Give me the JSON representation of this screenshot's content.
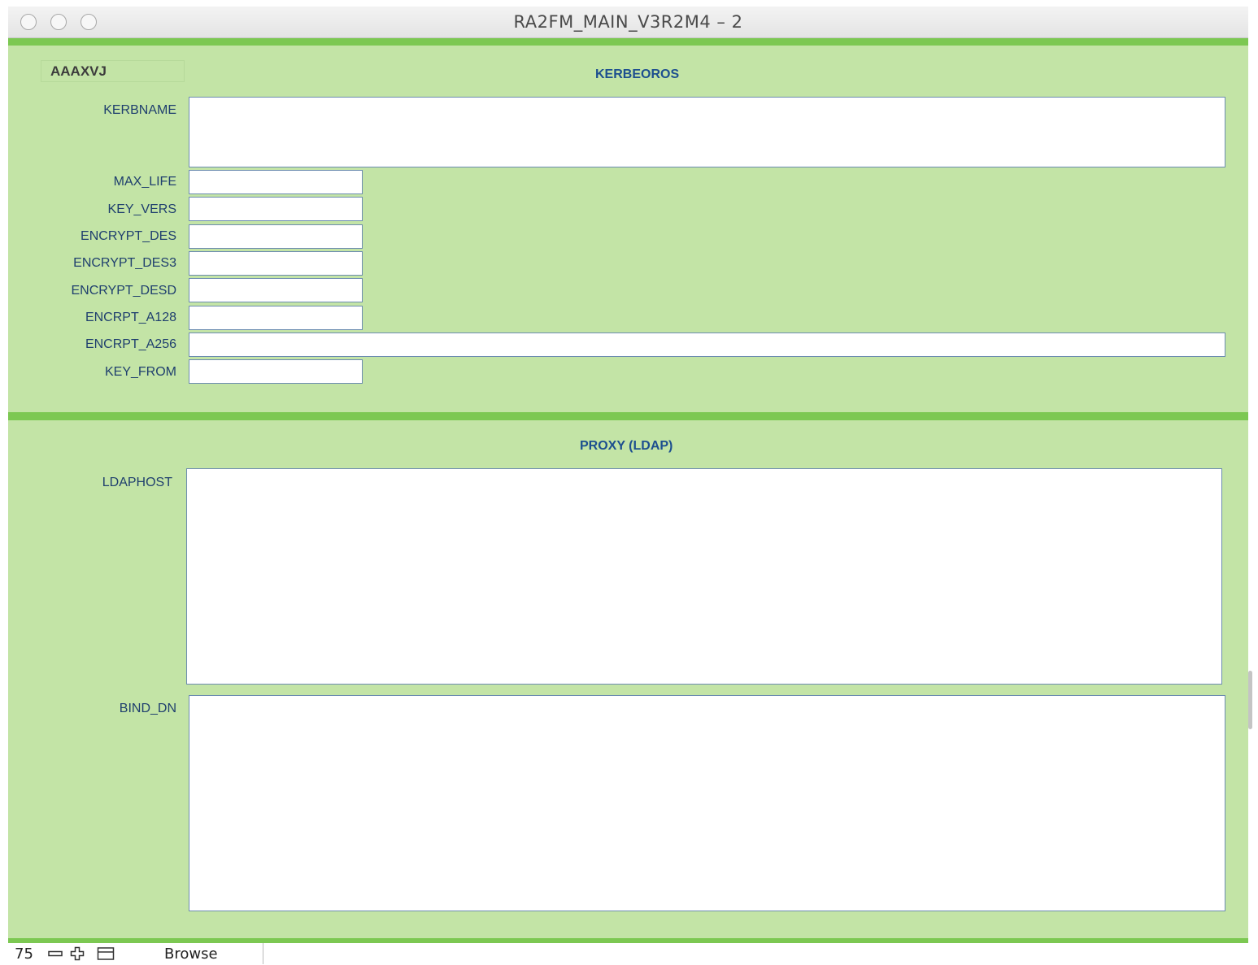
{
  "window": {
    "title": "RA2FM_MAIN_V3R2M4 – 2"
  },
  "record": {
    "id": "AAAXVJ"
  },
  "kerberos": {
    "title": "KERBEOROS",
    "fields": {
      "kerbname": {
        "label": "KERBNAME",
        "value": ""
      },
      "max_life": {
        "label": "MAX_LIFE",
        "value": ""
      },
      "key_vers": {
        "label": "KEY_VERS",
        "value": ""
      },
      "encrypt_des": {
        "label": "ENCRYPT_DES",
        "value": ""
      },
      "encrypt_des3": {
        "label": "ENCRYPT_DES3",
        "value": ""
      },
      "encrypt_desd": {
        "label": "ENCRYPT_DESD",
        "value": ""
      },
      "encrpt_a128": {
        "label": "ENCRPT_A128",
        "value": ""
      },
      "encrpt_a256": {
        "label": "ENCRPT_A256",
        "value": ""
      },
      "key_from": {
        "label": "KEY_FROM",
        "value": ""
      }
    }
  },
  "proxy": {
    "title": "PROXY (LDAP)",
    "fields": {
      "ldaphost": {
        "label": "LDAPHOST",
        "value": ""
      },
      "bind_dn": {
        "label": "BIND_DN",
        "value": ""
      }
    }
  },
  "statusbar": {
    "zoom": "75",
    "mode": "Browse",
    "icons": [
      "zoom-out-icon",
      "zoom-in-icon",
      "toggle-status-area-icon"
    ]
  },
  "colors": {
    "panel_bg": "#c3e4a6",
    "accent_rule": "#7cc852",
    "label_text": "#1f3f6e",
    "section_title": "#1d4f8f",
    "field_border": "#6c8cb0"
  }
}
